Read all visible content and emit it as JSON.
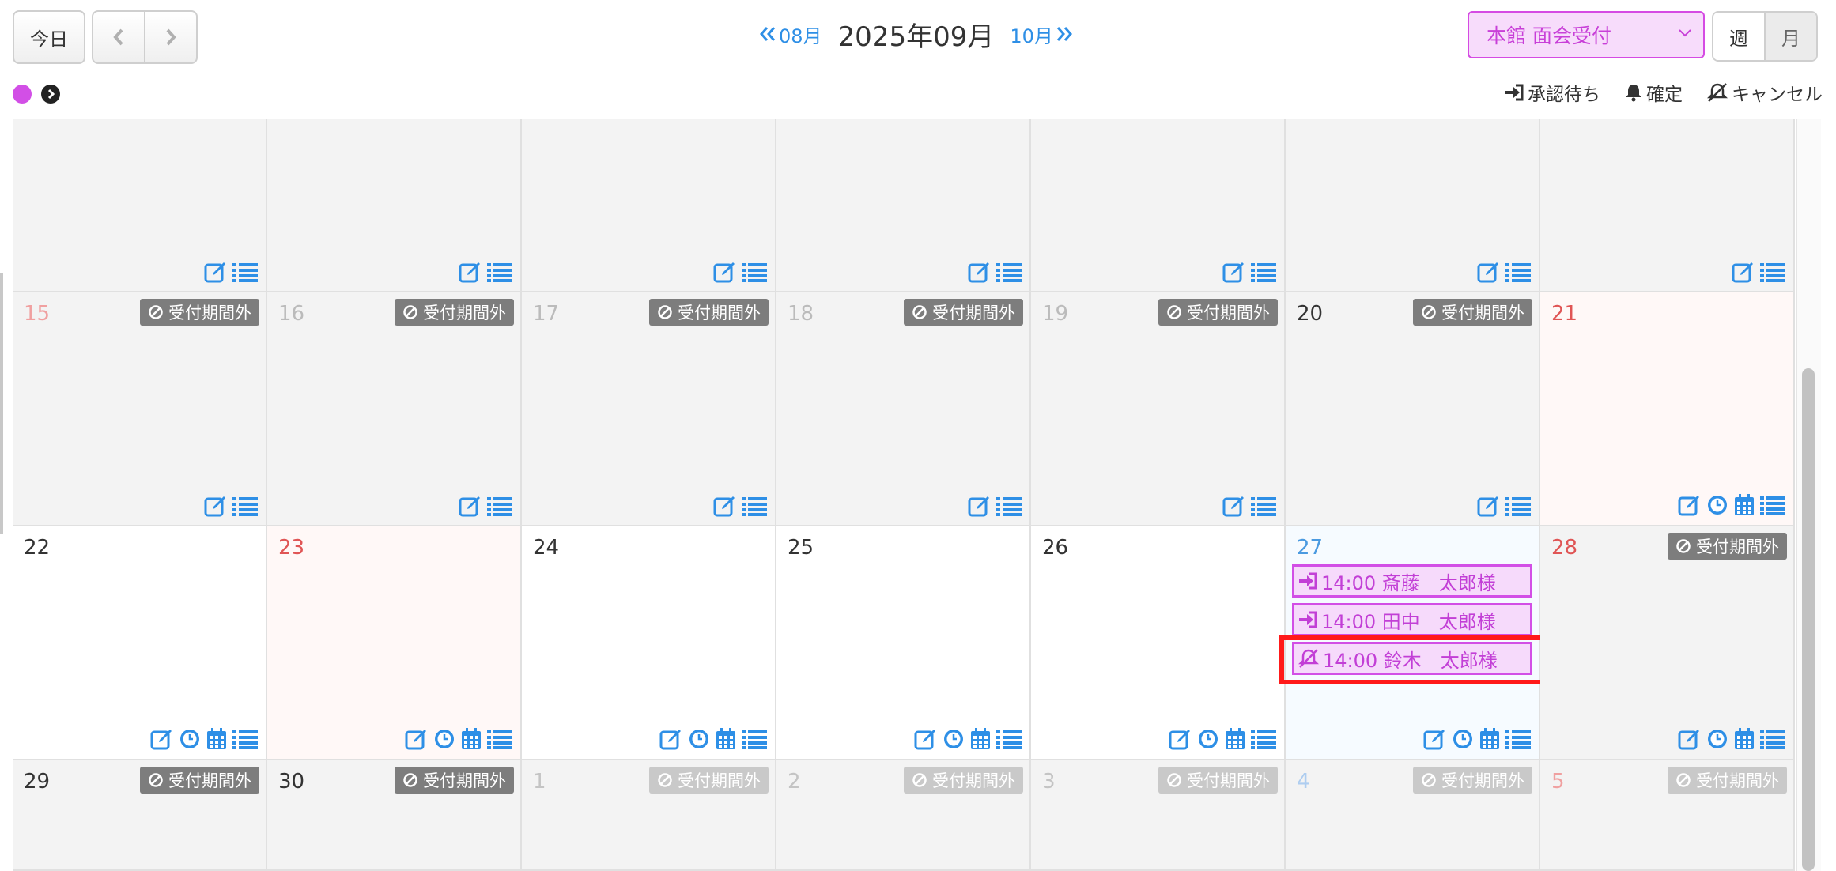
{
  "header": {
    "today_label": "今日",
    "prev_label": "08月",
    "current_label": "2025年09月",
    "next_label": "10月",
    "venue_select": "本館 面会受付",
    "view_week": "週",
    "view_month": "月"
  },
  "legend": {
    "pending": "承認待ち",
    "confirmed": "確定",
    "cancelled": "キャンセル"
  },
  "colors": {
    "accent": "#2e8fe6",
    "event": "#d24fe6",
    "holiday": "#e05555",
    "highlight": "#ff1a1a"
  },
  "calendar": {
    "weeks": [
      {
        "days": [
          {
            "label": "",
            "style": "out",
            "badge": "",
            "icons": "basic"
          },
          {
            "label": "",
            "style": "out",
            "badge": "",
            "icons": "basic"
          },
          {
            "label": "",
            "style": "out",
            "badge": "",
            "icons": "basic"
          },
          {
            "label": "",
            "style": "out",
            "badge": "",
            "icons": "basic"
          },
          {
            "label": "",
            "style": "out",
            "badge": "",
            "icons": "basic"
          },
          {
            "label": "",
            "style": "out",
            "badge": "",
            "icons": "basic"
          },
          {
            "label": "",
            "style": "out",
            "badge": "",
            "icons": "basic"
          }
        ]
      },
      {
        "days": [
          {
            "label": "15",
            "style": "out",
            "numColor": "#f0a0a0",
            "badge": "受付期間外",
            "badgeStyle": "dark",
            "icons": "basic"
          },
          {
            "label": "16",
            "style": "out",
            "numColor": "#bbbbbb",
            "badge": "受付期間外",
            "badgeStyle": "dark",
            "icons": "basic"
          },
          {
            "label": "17",
            "style": "out",
            "numColor": "#bbbbbb",
            "badge": "受付期間外",
            "badgeStyle": "dark",
            "icons": "basic"
          },
          {
            "label": "18",
            "style": "out",
            "numColor": "#bbbbbb",
            "badge": "受付期間外",
            "badgeStyle": "dark",
            "icons": "basic"
          },
          {
            "label": "19",
            "style": "out",
            "numColor": "#bbbbbb",
            "badge": "受付期間外",
            "badgeStyle": "dark",
            "icons": "basic"
          },
          {
            "label": "20",
            "style": "out",
            "numColor": "#333333",
            "badge": "受付期間外",
            "badgeStyle": "dark",
            "icons": "basic"
          },
          {
            "label": "21",
            "style": "holiday",
            "numColor": "#e05555",
            "badge": "",
            "icons": "full"
          }
        ]
      },
      {
        "days": [
          {
            "label": "22",
            "style": "normal",
            "numColor": "#333333",
            "badge": "",
            "icons": "full"
          },
          {
            "label": "23",
            "style": "holiday",
            "numColor": "#e05555",
            "badge": "",
            "icons": "full"
          },
          {
            "label": "24",
            "style": "normal",
            "numColor": "#333333",
            "badge": "",
            "icons": "full"
          },
          {
            "label": "25",
            "style": "normal",
            "numColor": "#333333",
            "badge": "",
            "icons": "full"
          },
          {
            "label": "26",
            "style": "normal",
            "numColor": "#333333",
            "badge": "",
            "icons": "full"
          },
          {
            "label": "27",
            "style": "today",
            "numColor": "#4a9ae0",
            "badge": "",
            "icons": "full",
            "events": [
              {
                "icon": "signin",
                "text": "14:00 斎藤　太郎様"
              },
              {
                "icon": "signin",
                "text": "14:00 田中　太郎様"
              },
              {
                "icon": "bellslash",
                "text": "14:00 鈴木　太郎様"
              }
            ]
          },
          {
            "label": "28",
            "style": "out",
            "numColor": "#e05555",
            "badge": "受付期間外",
            "badgeStyle": "dark",
            "icons": "full"
          }
        ]
      },
      {
        "days": [
          {
            "label": "29",
            "style": "out",
            "numColor": "#333333",
            "badge": "受付期間外",
            "badgeStyle": "dark",
            "icons": "none"
          },
          {
            "label": "30",
            "style": "out",
            "numColor": "#333333",
            "badge": "受付期間外",
            "badgeStyle": "dark",
            "icons": "none"
          },
          {
            "label": "1",
            "style": "out",
            "numColor": "#c4c4c4",
            "badge": "受付期間外",
            "badgeStyle": "light",
            "icons": "none"
          },
          {
            "label": "2",
            "style": "out",
            "numColor": "#c4c4c4",
            "badge": "受付期間外",
            "badgeStyle": "light",
            "icons": "none"
          },
          {
            "label": "3",
            "style": "out",
            "numColor": "#c4c4c4",
            "badge": "受付期間外",
            "badgeStyle": "light",
            "icons": "none"
          },
          {
            "label": "4",
            "style": "out",
            "numColor": "#aecdf0",
            "badge": "受付期間外",
            "badgeStyle": "light",
            "icons": "none"
          },
          {
            "label": "5",
            "style": "out",
            "numColor": "#f0a0a0",
            "badge": "受付期間外",
            "badgeStyle": "light",
            "icons": "none"
          }
        ]
      }
    ]
  }
}
